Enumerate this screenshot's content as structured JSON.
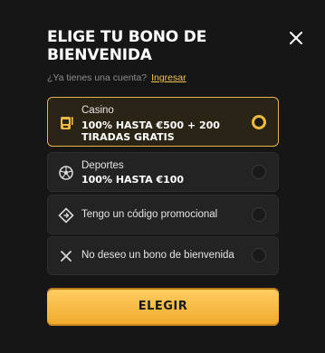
{
  "modal": {
    "title": "ELIGE TU BONO DE\nBIENVENIDA",
    "close_icon": "close-icon"
  },
  "account": {
    "question": "¿Ya tienes una cuenta?",
    "login_link": "Ingresar"
  },
  "options": [
    {
      "label": "Casino",
      "offer": "100% HASTA €500 + 200\nTIRADAS GRATIS",
      "icon": "slot-machine-icon",
      "selected": true
    },
    {
      "label": "Deportes",
      "offer": "100% HASTA €100",
      "icon": "soccer-ball-icon",
      "selected": false
    },
    {
      "label": "Tengo un código promocional",
      "icon": "promo-code-icon",
      "selected": false
    },
    {
      "label": "No deseo un bono de bienvenida",
      "icon": "x-icon",
      "selected": false
    }
  ],
  "cta": {
    "label": "ELEGIR"
  },
  "colors": {
    "accent": "#f0b93e",
    "background": "#161616",
    "card": "#232323"
  }
}
